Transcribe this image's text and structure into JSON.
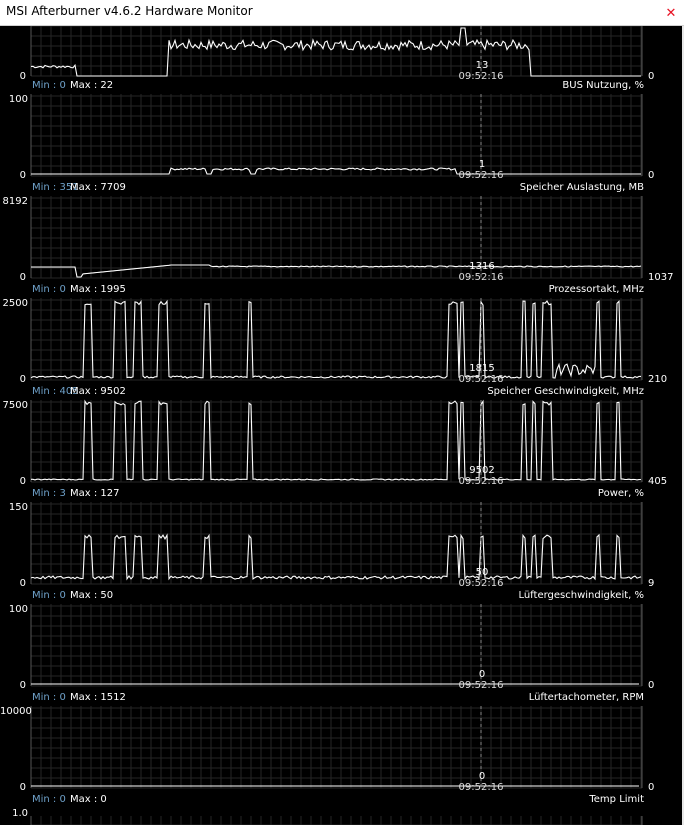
{
  "window": {
    "title": "MSI Afterburner v4.6.2 Hardware Monitor",
    "close_icon": "close-icon"
  },
  "cursor_time": "09:52:16",
  "top_graph": {
    "name": "BUS Nutzung, %",
    "cursor_value": "13",
    "min_axis": "0",
    "current": "0"
  },
  "graphs": [
    {
      "label": "BUS Nutzung, %",
      "min": "Min : 0",
      "max": "Max : 22",
      "axis_max": "100",
      "axis_min": "0",
      "current": "0",
      "cursor_value": "1",
      "values_hint": "flat"
    },
    {
      "label": "Speicher Auslastung, MB",
      "min": "Min : 351",
      "max": "Max : 7709",
      "axis_max": "8192",
      "axis_min": "0",
      "current": "1037",
      "cursor_value": "1316"
    },
    {
      "label": "Prozessortakt, MHz",
      "min": "Min : 0",
      "max": "Max : 1995",
      "axis_max": "2500",
      "axis_min": "0",
      "current": "210",
      "cursor_value": "1815"
    },
    {
      "label": "Speicher Geschwindigkeit, MHz",
      "min": "Min : 405",
      "max": "Max : 9502",
      "axis_max": "7500",
      "axis_min": "0",
      "current": "405",
      "cursor_value": "9502"
    },
    {
      "label": "Power, %",
      "min": "Min : 3",
      "max": "Max : 127",
      "axis_max": "150",
      "axis_min": "0",
      "current": "9",
      "cursor_value": "50"
    },
    {
      "label": "Lüftergeschwindigkeit, %",
      "min": "Min : 0",
      "max": "Max : 50",
      "axis_max": "100",
      "axis_min": "0",
      "current": "0",
      "cursor_value": "0"
    },
    {
      "label": "Lüftertachometer, RPM",
      "min": "Min : 0",
      "max": "Max : 1512",
      "axis_max": "10000",
      "axis_min": "0",
      "current": "0",
      "cursor_value": "0"
    },
    {
      "label": "Temp Limit",
      "min": "Min : 0",
      "max": "Max : 0",
      "axis_max": "1.0",
      "axis_min": "",
      "current": "",
      "cursor_value": ""
    }
  ]
}
